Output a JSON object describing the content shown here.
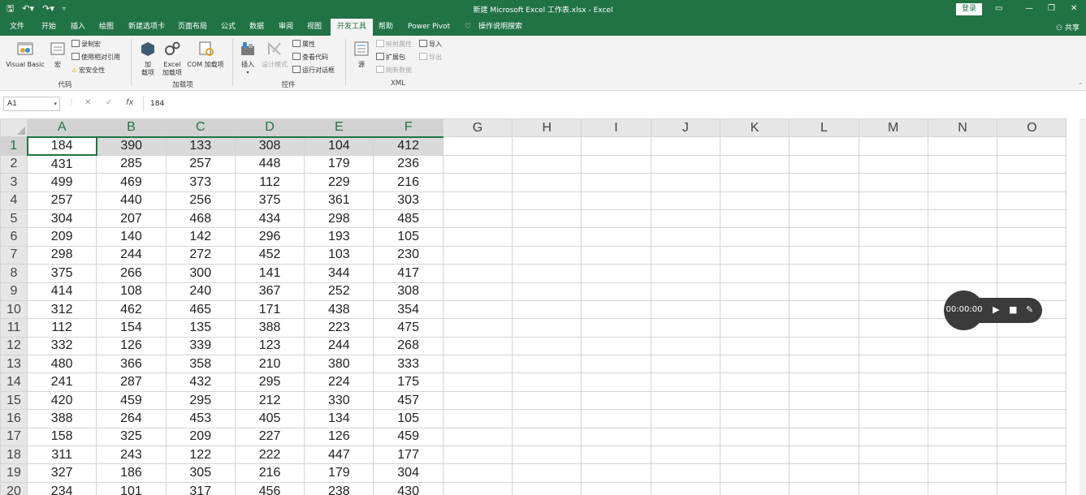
{
  "app": {
    "window_title": "新建 Microsoft Excel 工作表.xlsx  -  Excel",
    "login_label": "登录",
    "share_label": "共享"
  },
  "tabs": [
    {
      "label": "文件"
    },
    {
      "label": "开始"
    },
    {
      "label": "插入"
    },
    {
      "label": "绘图"
    },
    {
      "label": "新建选项卡"
    },
    {
      "label": "页面布局"
    },
    {
      "label": "公式"
    },
    {
      "label": "数据"
    },
    {
      "label": "审阅"
    },
    {
      "label": "视图"
    },
    {
      "label": "开发工具"
    },
    {
      "label": "帮助"
    },
    {
      "label": "Power Pivot"
    },
    {
      "label": "操作说明搜索"
    }
  ],
  "ribbon": {
    "code": {
      "group_label": "代码",
      "visual_basic": "Visual Basic",
      "macro": "宏",
      "record_macro": "录制宏",
      "relative_ref": "使用相对引用",
      "macro_security": "宏安全性"
    },
    "addins": {
      "group_label": "加载项",
      "addin_line1": "加",
      "addin_line2": "载项",
      "excel_addin_line1": "Excel",
      "excel_addin_line2": "加载项",
      "com_addin": "COM 加载项"
    },
    "controls": {
      "group_label": "控件",
      "insert": "插入",
      "design_mode": "设计模式",
      "properties": "属性",
      "view_code": "查看代码",
      "run_dialog": "运行对话框"
    },
    "xml": {
      "group_label": "XML",
      "source": "源",
      "map_props": "映射属性",
      "expansion_pack": "扩展包",
      "refresh_data": "刷新数据",
      "import": "导入",
      "export": "导出"
    }
  },
  "formula_bar": {
    "name_box": "A1",
    "cancel_symbol": "✕",
    "enter_symbol": "✓",
    "fx_symbol": "fx",
    "formula": "184"
  },
  "sheet": {
    "columns": [
      "A",
      "B",
      "C",
      "D",
      "E",
      "F",
      "G",
      "H",
      "I",
      "J",
      "K",
      "L",
      "M",
      "N",
      "O"
    ],
    "rows": [
      {
        "n": "1",
        "v": [
          "184",
          "390",
          "133",
          "308",
          "104",
          "412"
        ]
      },
      {
        "n": "2",
        "v": [
          "431",
          "285",
          "257",
          "448",
          "179",
          "236"
        ]
      },
      {
        "n": "3",
        "v": [
          "499",
          "469",
          "373",
          "112",
          "229",
          "216"
        ]
      },
      {
        "n": "4",
        "v": [
          "257",
          "440",
          "256",
          "375",
          "361",
          "303"
        ]
      },
      {
        "n": "5",
        "v": [
          "304",
          "207",
          "468",
          "434",
          "298",
          "485"
        ]
      },
      {
        "n": "6",
        "v": [
          "209",
          "140",
          "142",
          "296",
          "193",
          "105"
        ]
      },
      {
        "n": "7",
        "v": [
          "298",
          "244",
          "272",
          "452",
          "103",
          "230"
        ]
      },
      {
        "n": "8",
        "v": [
          "375",
          "266",
          "300",
          "141",
          "344",
          "417"
        ]
      },
      {
        "n": "9",
        "v": [
          "414",
          "108",
          "240",
          "367",
          "252",
          "308"
        ]
      },
      {
        "n": "10",
        "v": [
          "312",
          "462",
          "465",
          "171",
          "438",
          "354"
        ]
      },
      {
        "n": "11",
        "v": [
          "112",
          "154",
          "135",
          "388",
          "223",
          "475"
        ]
      },
      {
        "n": "12",
        "v": [
          "332",
          "126",
          "339",
          "123",
          "244",
          "268"
        ]
      },
      {
        "n": "13",
        "v": [
          "480",
          "366",
          "358",
          "210",
          "380",
          "333"
        ]
      },
      {
        "n": "14",
        "v": [
          "241",
          "287",
          "432",
          "295",
          "224",
          "175"
        ]
      },
      {
        "n": "15",
        "v": [
          "420",
          "459",
          "295",
          "212",
          "330",
          "457"
        ]
      },
      {
        "n": "16",
        "v": [
          "388",
          "264",
          "453",
          "405",
          "134",
          "105"
        ]
      },
      {
        "n": "17",
        "v": [
          "158",
          "325",
          "209",
          "227",
          "126",
          "459"
        ]
      },
      {
        "n": "18",
        "v": [
          "311",
          "243",
          "122",
          "222",
          "447",
          "177"
        ]
      },
      {
        "n": "19",
        "v": [
          "327",
          "186",
          "305",
          "216",
          "179",
          "304"
        ]
      },
      {
        "n": "20",
        "v": [
          "234",
          "101",
          "317",
          "456",
          "238",
          "430"
        ]
      }
    ],
    "selected_range": "A1:F1"
  },
  "recorder": {
    "time": "00:00:00"
  },
  "colors": {
    "accent": "#217346",
    "recorder_bg": "#3b3b3b"
  }
}
